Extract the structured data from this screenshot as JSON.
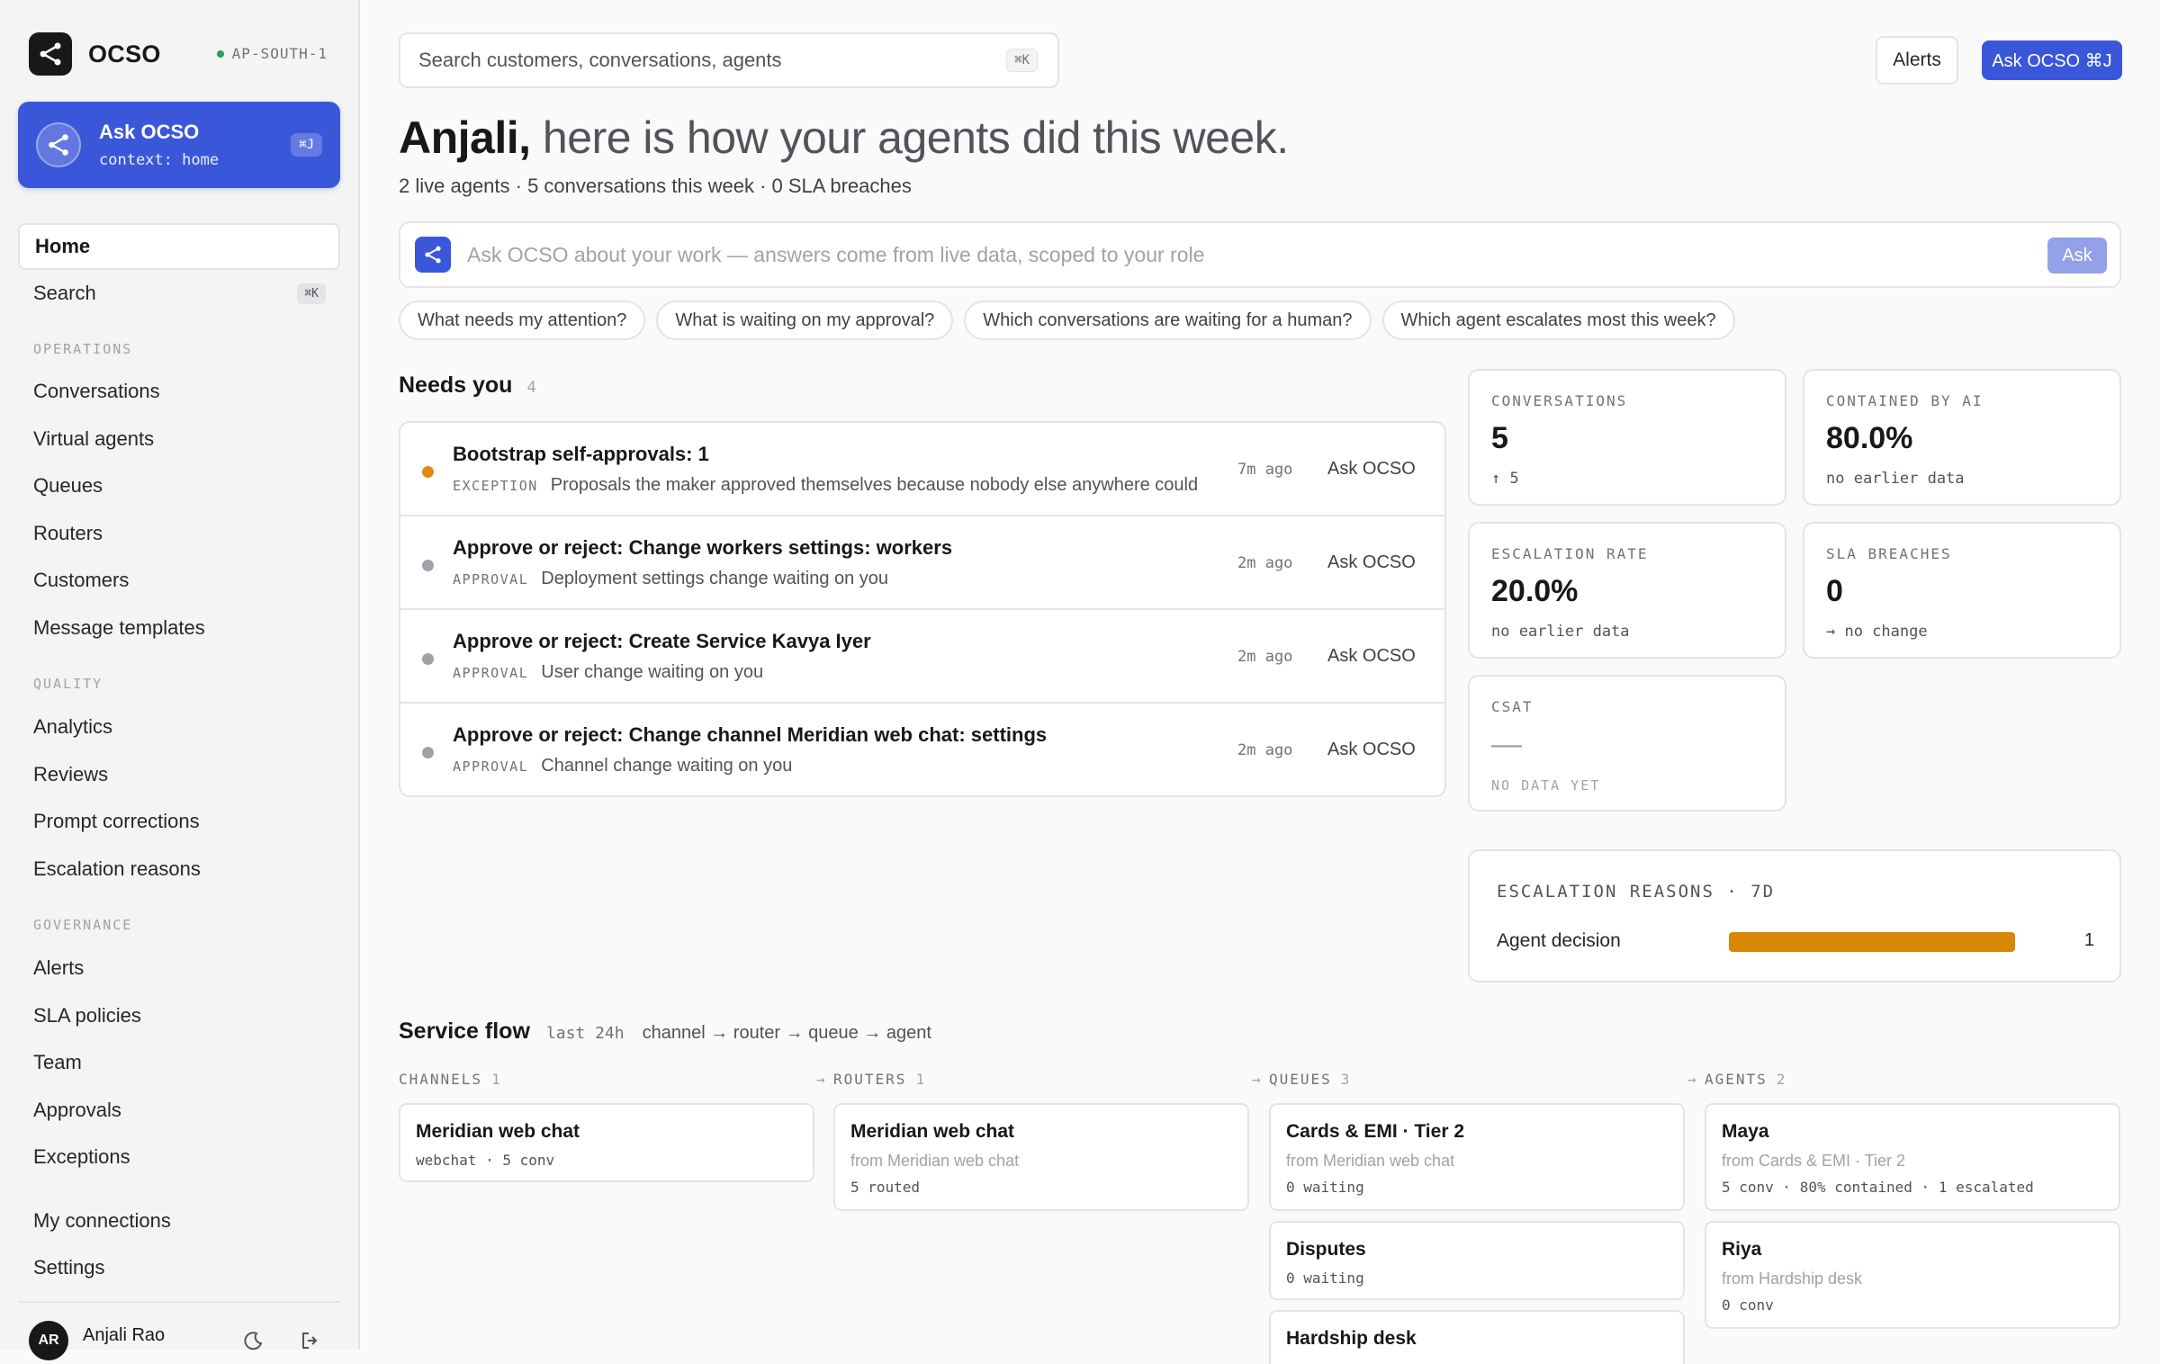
{
  "brand": {
    "name": "OCSO",
    "region": "AP-SOUTH-1"
  },
  "ask_card": {
    "title": "Ask OCSO",
    "context": "context: home",
    "shortcut": "⌘J"
  },
  "nav": {
    "home": "Home",
    "search": "Search",
    "search_shortcut": "⌘K",
    "sections": {
      "operations": "OPERATIONS",
      "quality": "QUALITY",
      "governance": "GOVERNANCE"
    },
    "operations": [
      "Conversations",
      "Virtual agents",
      "Queues",
      "Routers",
      "Customers",
      "Message templates"
    ],
    "quality": [
      "Analytics",
      "Reviews",
      "Prompt corrections",
      "Escalation reasons"
    ],
    "governance": [
      "Alerts",
      "SLA policies",
      "Team",
      "Approvals",
      "Exceptions"
    ],
    "footer": [
      "My connections",
      "Settings"
    ]
  },
  "user": {
    "initials": "AR",
    "name": "Anjali Rao"
  },
  "topbar": {
    "search_placeholder": "Search customers, conversations, agents",
    "search_shortcut": "⌘K",
    "alerts_label": "Alerts",
    "ask_label": "Ask OCSO ⌘J"
  },
  "greeting": {
    "name": "Anjali,",
    "rest": " here is how your agents did this week.",
    "summary": "2 live agents · 5 conversations this week · 0 SLA breaches"
  },
  "askbar": {
    "placeholder": "Ask OCSO about your work — answers come from live data, scoped to your role",
    "button": "Ask"
  },
  "chips": [
    "What needs my attention?",
    "What is waiting on my approval?",
    "Which conversations are waiting for a human?",
    "Which agent escalates most this week?"
  ],
  "needs": {
    "title": "Needs you",
    "count": "4",
    "items": [
      {
        "title": "Bootstrap self-approvals: 1",
        "tag": "EXCEPTION",
        "desc": "Proposals the maker approved themselves because nobody else anywhere could",
        "time": "7m ago",
        "action": "Ask OCSO",
        "dot_color": "#e08a12"
      },
      {
        "title": "Approve or reject: Change workers settings: workers",
        "tag": "APPROVAL",
        "desc": "Deployment settings change waiting on you",
        "time": "2m ago",
        "action": "Ask OCSO",
        "dot_color": "#a1a1aa"
      },
      {
        "title": "Approve or reject: Create Service Kavya Iyer",
        "tag": "APPROVAL",
        "desc": "User change waiting on you",
        "time": "2m ago",
        "action": "Ask OCSO",
        "dot_color": "#a1a1aa"
      },
      {
        "title": "Approve or reject: Change channel Meridian web chat: settings",
        "tag": "APPROVAL",
        "desc": "Channel change waiting on you",
        "time": "2m ago",
        "action": "Ask OCSO",
        "dot_color": "#a1a1aa"
      }
    ]
  },
  "metrics": {
    "conversations": {
      "label": "CONVERSATIONS",
      "value": "5",
      "note": "↑ 5"
    },
    "contained": {
      "label": "CONTAINED BY AI",
      "value": "80.0%",
      "note": "no earlier data"
    },
    "escalation": {
      "label": "ESCALATION RATE",
      "value": "20.0%",
      "note": "no earlier data"
    },
    "sla": {
      "label": "SLA BREACHES",
      "value": "0",
      "note": "→ no change"
    },
    "csat": {
      "label": "CSAT",
      "value": "—",
      "note": "NO DATA YET"
    }
  },
  "escalation_reasons": {
    "title": "ESCALATION REASONS · 7D",
    "items": [
      {
        "label": "Agent decision",
        "value": "1",
        "fraction": 1.0
      }
    ],
    "bar_color": "#d98706"
  },
  "flow": {
    "title": "Service flow",
    "window": "last 24h",
    "path": "channel → router → queue → agent",
    "arrow": "→",
    "columns": {
      "channels": {
        "label": "CHANNELS",
        "count": "1"
      },
      "routers": {
        "label": "ROUTERS",
        "count": "1"
      },
      "queues": {
        "label": "QUEUES",
        "count": "3"
      },
      "agents": {
        "label": "AGENTS",
        "count": "2"
      }
    },
    "channels": [
      {
        "title": "Meridian web chat",
        "meta": "webchat · 5 conv"
      }
    ],
    "routers": [
      {
        "title": "Meridian web chat",
        "from": "from Meridian web chat",
        "meta": "5 routed"
      }
    ],
    "queues": [
      {
        "title": "Cards & EMI · Tier 2",
        "from": "from Meridian web chat",
        "meta": "0 waiting"
      },
      {
        "title": "Disputes",
        "meta": "0 waiting"
      },
      {
        "title": "Hardship desk"
      }
    ],
    "agents": [
      {
        "title": "Maya",
        "from": "from Cards & EMI · Tier 2",
        "meta": "5 conv · 80% contained · 1 escalated"
      },
      {
        "title": "Riya",
        "from": "from Hardship desk",
        "meta": "0 conv"
      }
    ]
  },
  "colors": {
    "accent": "#3b57d9",
    "warning": "#e08a12",
    "ok": "#22a35a"
  }
}
